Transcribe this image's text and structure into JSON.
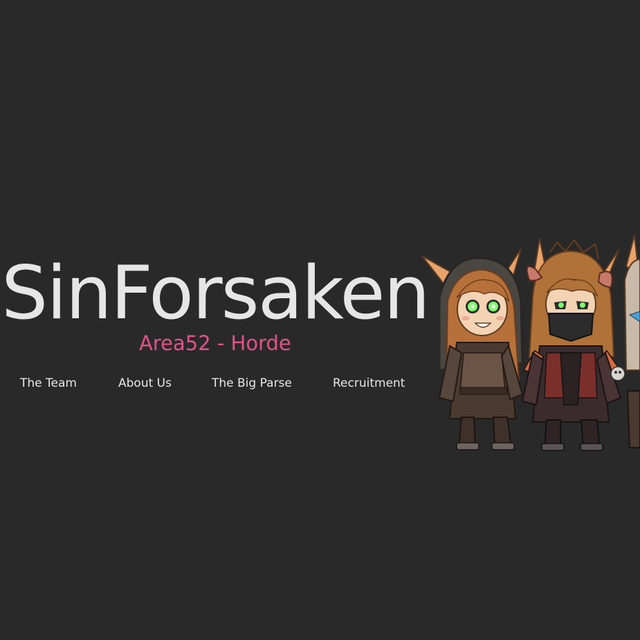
{
  "header": {
    "title": "SinForsaken",
    "subtitle": "Area52 - Horde"
  },
  "nav": {
    "items": [
      {
        "label": "The Team"
      },
      {
        "label": "About Us"
      },
      {
        "label": "The Big Parse"
      },
      {
        "label": "Recruitment"
      }
    ]
  },
  "colors": {
    "background": "#292929",
    "title": "#e6e6e6",
    "subtitle_accent": "#e3528a",
    "nav_text": "#e8e8e8"
  },
  "hero_art": {
    "subject": "chibi-blood-elf-characters-illustration"
  }
}
